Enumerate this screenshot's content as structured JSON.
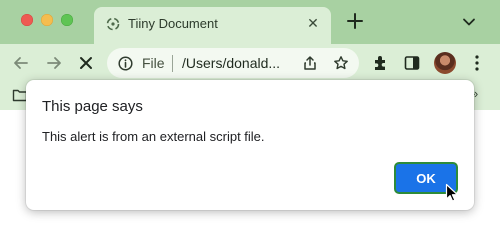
{
  "window": {
    "tab": {
      "title": "Tiiny Document",
      "close_glyph": "✕",
      "favicon": "tiiny-favicon-icon"
    }
  },
  "toolbar": {
    "scheme_label": "File",
    "url": "/Users/donald...",
    "icons": [
      "back-icon",
      "forward-icon",
      "stop-icon",
      "info-icon",
      "share-icon",
      "star-icon",
      "extensions-icon",
      "side-panel-icon",
      "avatar",
      "kebab-menu-icon"
    ]
  },
  "bookmarks": {
    "more_glyph": "»"
  },
  "dialog": {
    "title": "This page says",
    "message": "This alert is from an external script file.",
    "ok_label": "OK"
  },
  "colors": {
    "chrome_dark": "#a8d1a2",
    "chrome_light": "#dbeed6",
    "accent_button": "#1a73e8",
    "focus_ring": "#2e8b3a"
  }
}
